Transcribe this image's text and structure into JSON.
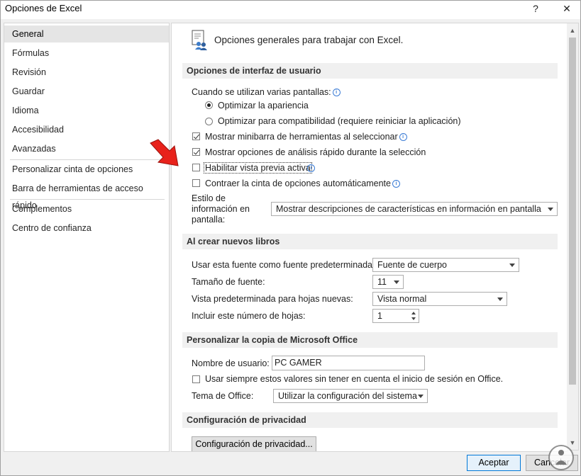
{
  "window": {
    "title": "Opciones de Excel",
    "help_label": "?",
    "close_label": "✕"
  },
  "sidebar": {
    "items": [
      {
        "label": "General"
      },
      {
        "label": "Fórmulas"
      },
      {
        "label": "Revisión"
      },
      {
        "label": "Guardar"
      },
      {
        "label": "Idioma"
      },
      {
        "label": "Accesibilidad"
      },
      {
        "label": "Avanzadas"
      },
      {
        "label": "Personalizar cinta de opciones"
      },
      {
        "label": "Barra de herramientas de acceso rápido"
      },
      {
        "label": "Complementos"
      },
      {
        "label": "Centro de confianza"
      }
    ],
    "selected": "General"
  },
  "main": {
    "heading": "Opciones generales para trabajar con Excel.",
    "section_ui": {
      "title": "Opciones de interfaz de usuario",
      "multi_screen_label": "Cuando se utilizan varias pantallas:",
      "radio_optimize_appearance": "Optimizar la apariencia",
      "radio_optimize_compat": "Optimizar para compatibilidad (requiere reiniciar la aplicación)",
      "cb_minibar": "Mostrar minibarra de herramientas al seleccionar",
      "cb_quick_analysis": "Mostrar opciones de análisis rápido durante la selección",
      "cb_live_preview": "Habilitar vista previa activa",
      "cb_collapse_ribbon": "Contraer la cinta de opciones automáticamente",
      "screentip_label_1": "Estilo de",
      "screentip_label_2": "información en",
      "screentip_label_3": "pantalla:",
      "screentip_value": "Mostrar descripciones de características en información en pantalla"
    },
    "section_new_books": {
      "title": "Al crear nuevos libros",
      "font_label": "Usar esta fuente como fuente predeterminada:",
      "font_value": "Fuente de cuerpo",
      "size_label": "Tamaño de fuente:",
      "size_value": "11",
      "view_label": "Vista predeterminada para hojas nuevas:",
      "view_value": "Vista normal",
      "sheets_label": "Incluir este número de hojas:",
      "sheets_value": "1"
    },
    "section_office": {
      "title": "Personalizar la copia de Microsoft Office",
      "username_label": "Nombre de usuario:",
      "username_value": "PC GAMER",
      "always_use_label": "Usar siempre estos valores sin tener en cuenta el inicio de sesión en Office.",
      "theme_label": "Tema de Office:",
      "theme_value": "Utilizar la configuración del sistema"
    },
    "section_privacy": {
      "title": "Configuración de privacidad",
      "button_label": "Configuración de privacidad..."
    }
  },
  "footer": {
    "ok_label": "Aceptar",
    "cancel_label": "Cancelar"
  },
  "colors": {
    "accent": "#0078d7",
    "arrow_red": "#e8221b",
    "section_bg": "#f0f0f0",
    "selected_nav": "#e5e5e5"
  },
  "icons": {
    "heading_icon": "general-options-icon",
    "info_icon": "info-icon",
    "pointer_arrow": "red-arrow-icon",
    "watermark": "logo-icon"
  }
}
